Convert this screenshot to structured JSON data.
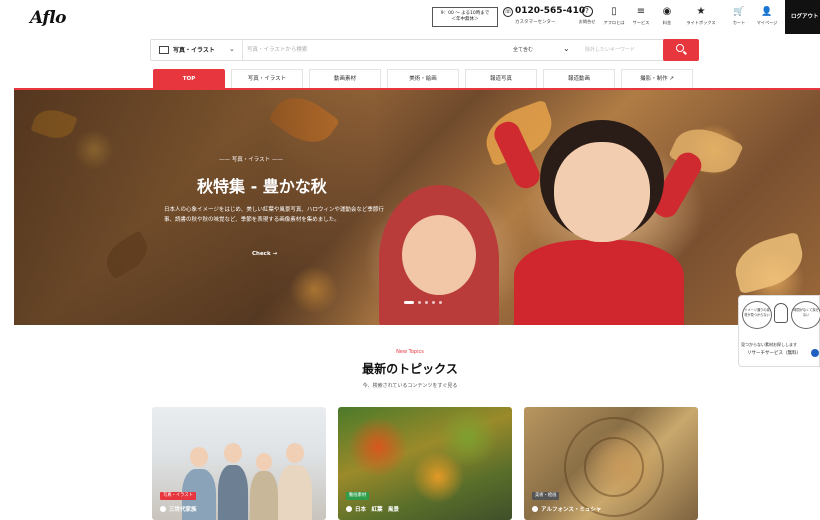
{
  "header": {
    "logo": "Aflo",
    "hours_line1": "9：00 ～ よる10時まで",
    "hours_line2": "＜年中無休＞",
    "phone_number": "0120-565-410",
    "phone_label": "カスタマーセンター",
    "items": [
      {
        "label": "お問合せ",
        "icon": "question-icon",
        "glyph": "?"
      },
      {
        "label": "アフロとは",
        "icon": "book-icon",
        "glyph": "▯"
      },
      {
        "label": "サービス",
        "icon": "menu-icon",
        "glyph": "≡"
      },
      {
        "label": "料金",
        "icon": "price-icon",
        "glyph": "◉"
      },
      {
        "label": "ライトボックス",
        "icon": "star-icon",
        "glyph": "★"
      },
      {
        "label": "カート",
        "icon": "cart-icon",
        "glyph": "🛒"
      },
      {
        "label": "マイページ",
        "icon": "user-icon",
        "glyph": "👤"
      }
    ],
    "logout": "ログアウト"
  },
  "search": {
    "category": "写真・イラスト",
    "placeholder": "写真・イラストから検索",
    "match_mode": "全て含む",
    "exclude_placeholder": "除外したいキーワード"
  },
  "nav": {
    "tabs": [
      "TOP",
      "写真・イラスト",
      "動画素材",
      "美術・絵画",
      "報道写真",
      "報道動画",
      "撮影・制作 ↗"
    ],
    "active": "TOP"
  },
  "hero": {
    "eyebrow": "—— 写真・イラスト ——",
    "title": "秋特集 - 豊かな秋",
    "description": "日本人の心象イメージをはじめ、美しい紅葉や風景写真、ハロウィンや運動会など季節行事、読書の秋や秋の味覚など、季節を表現する画像素材を集めました。",
    "cta": "Check →",
    "slide_count": 5,
    "active_slide": 0
  },
  "research": {
    "bubble1": "イメージ通りの素材が見つからない",
    "bubble2": "時間がなくて探せない",
    "line1": "見つからない素材お探しします",
    "line2": "リサーチサービス（無料）"
  },
  "topics": {
    "label_en": "New Topics",
    "title": "最新のトピックス",
    "subtitle": "今、検索されているコンテンツをすぐ見る",
    "cards": [
      {
        "tag": "写真・イラスト",
        "title": "三世代家族",
        "tag_color": "#e8363e"
      },
      {
        "tag": "動画素材",
        "title": "日本　紅葉　風景",
        "tag_color": "#2e9e4a"
      },
      {
        "tag": "美術・絵画",
        "title": "アルフォンス・ミュシャ",
        "tag_color": "#555555"
      }
    ]
  },
  "colors": {
    "accent": "#e8363e",
    "dark": "#111111"
  }
}
